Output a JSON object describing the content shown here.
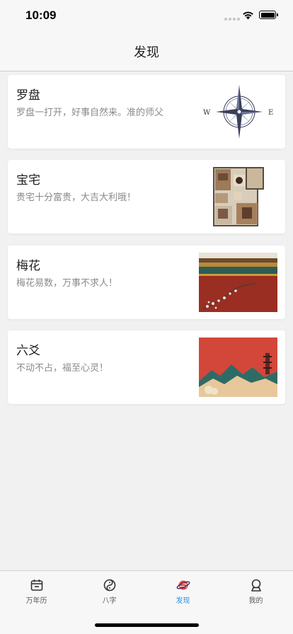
{
  "status_bar": {
    "time": "10:09"
  },
  "nav": {
    "title": "发现"
  },
  "cards": [
    {
      "title": "罗盘",
      "desc": "罗盘一打开，好事自然来。准的师父",
      "image": "compass-image",
      "compass_w": "W",
      "compass_e": "E"
    },
    {
      "title": "宝宅",
      "desc": "贵宅十分富贵，大吉大利哦！",
      "image": "floor-plan-image"
    },
    {
      "title": "梅花",
      "desc": "梅花易数，万事不求人！",
      "image": "palace-wall-plum-image"
    },
    {
      "title": "六爻",
      "desc": "不动不占，福至心灵！",
      "image": "red-mountain-landscape-image"
    }
  ],
  "tabs": [
    {
      "label": "万年历",
      "icon": "calendar-icon",
      "active": false
    },
    {
      "label": "八字",
      "icon": "yin-yang-icon",
      "active": false
    },
    {
      "label": "发现",
      "icon": "planet-icon",
      "active": true
    },
    {
      "label": "我的",
      "icon": "person-icon",
      "active": false
    }
  ],
  "colors": {
    "accent": "#2f8ee0",
    "background": "#f1f1f1",
    "card": "#ffffff"
  }
}
